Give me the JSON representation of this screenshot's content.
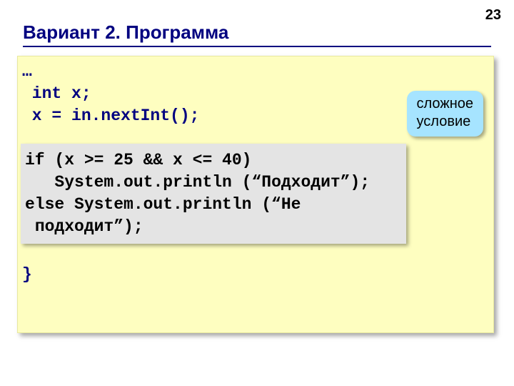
{
  "page_number": "23",
  "title": "Вариант 2. Программа",
  "callout": {
    "line1": "сложное",
    "line2": "условие"
  },
  "code_top": "…\n int x;\n x = in.nextInt();",
  "code_bottom": "}",
  "inner_code": "if (x >= 25 && x <= 40)\n   System.out.println (“Подходит”);\nelse System.out.println (“Не\n подходит”);"
}
